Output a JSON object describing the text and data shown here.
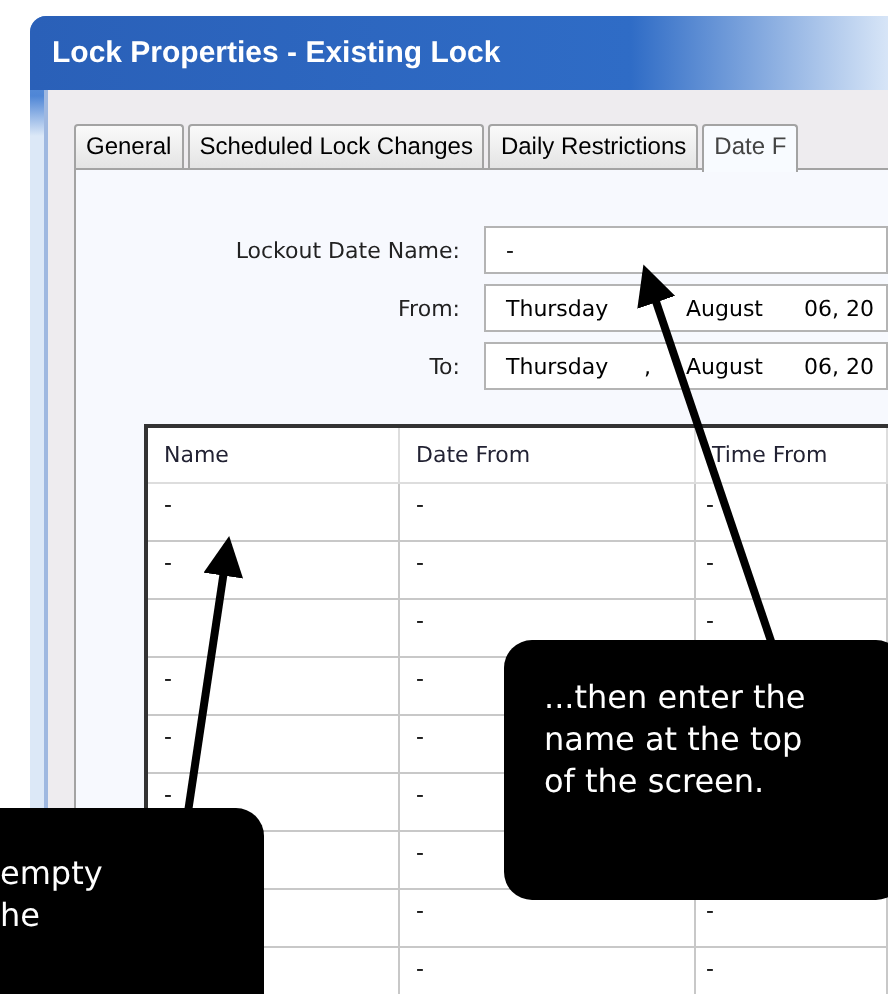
{
  "window": {
    "title": "Lock Properties - Existing Lock"
  },
  "tabs": [
    {
      "label": "General",
      "selected": false
    },
    {
      "label": "Scheduled Lock Changes",
      "selected": false
    },
    {
      "label": "Daily Restrictions",
      "selected": false
    },
    {
      "label": "Date F",
      "selected": true
    }
  ],
  "form": {
    "name_label": "Lockout Date Name:",
    "name_value": "-",
    "from_label": "From:",
    "from_value": {
      "day": "Thursday",
      "month": "August",
      "date": "06, 20"
    },
    "to_label": "To:",
    "to_value": {
      "day": "Thursday",
      "sep": ",",
      "month": "August",
      "date": "06, 20"
    }
  },
  "table": {
    "columns": [
      "Name",
      "Date From",
      "Time From"
    ],
    "rows": [
      {
        "name": "-",
        "date_from": "-",
        "time_from": "-"
      },
      {
        "name": "-",
        "date_from": "-",
        "time_from": "-"
      },
      {
        "date_from": "-",
        "time_from": "-"
      },
      {
        "name": "-",
        "date_from": "-"
      },
      {
        "name": "-",
        "date_from": "-"
      },
      {
        "name": "-",
        "date_from": "-"
      },
      {
        "date_from": "-"
      },
      {
        "date_from": "-",
        "time_from": "-"
      },
      {
        "date_from": "-",
        "time_from": "-"
      }
    ]
  },
  "callouts": [
    {
      "lines": [
        "...then enter the",
        "name at the top",
        "of the screen."
      ]
    },
    {
      "lines": [
        "empty",
        "he"
      ]
    }
  ]
}
